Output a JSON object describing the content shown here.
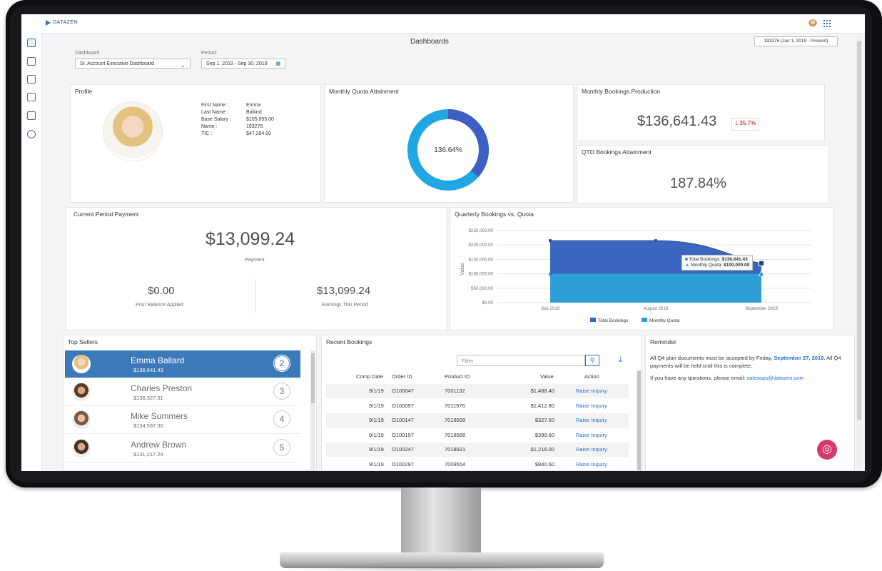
{
  "app": {
    "logo": "DATAZEN",
    "page_title": "Dashboards",
    "period_badge": "193276 (Jan 1, 2019 - Present)"
  },
  "filters": {
    "dashboard_label": "Dashboard",
    "dashboard_value": "Sr. Account Executive Dashboard",
    "period_label": "Period:",
    "period_value": "Sep 1, 2019 - Sep 30, 2019"
  },
  "profile": {
    "title": "Profile",
    "fields": [
      {
        "label": "First Name :",
        "value": "Emma"
      },
      {
        "label": "Last Name :",
        "value": "Ballard"
      },
      {
        "label": "Base Salary :",
        "value": "$105,855.00"
      },
      {
        "label": "Name :",
        "value": "193276"
      },
      {
        "label": "TIC :",
        "value": "$47,284.00"
      }
    ]
  },
  "quota": {
    "title": "Monthly Quota Attainment",
    "value_label": "136.64%",
    "value": 136.64,
    "colors": {
      "base": "#1fa6e3",
      "over": "#3d5fc4"
    }
  },
  "bookings": {
    "title": "Monthly Bookings Production",
    "value": "$136,641.43",
    "trend": "35.7%",
    "trend_color": "#bb0000"
  },
  "qtd": {
    "title": "QTD Bookings Attainment",
    "value": "187.84%"
  },
  "payment": {
    "title": "Current Period Payment",
    "value": "$13,099.24",
    "caption": "Payment",
    "prior_value": "$0.00",
    "prior_caption": "Prior Balance Applied",
    "earnings_value": "$13,099.24",
    "earnings_caption": "Earnings This Period"
  },
  "quarterly": {
    "title": "Quarterly Bookings vs. Quota",
    "tooltip": [
      {
        "label": "Total Bookings:",
        "value": "$136,641.43"
      },
      {
        "label": "Monthly Quota:",
        "value": "$100,000.00"
      }
    ]
  },
  "chart_data": {
    "type": "area",
    "title": "Quarterly Bookings vs. Quota",
    "ylabel": "Value",
    "xlabel": "",
    "categories": [
      "July 2019",
      "August 2019",
      "September 2019"
    ],
    "y_ticks": [
      "$250,000.00",
      "$200,000.00",
      "$150,000.00",
      "$100,000.00",
      "$50,000.00",
      "$0.00"
    ],
    "ylim": [
      0,
      250000
    ],
    "grid": true,
    "legend": "bottom",
    "series": [
      {
        "name": "Total Bookings",
        "values": [
          215000,
          215000,
          136641.43
        ],
        "color": "#3a66bf"
      },
      {
        "name": "Monthly Quota",
        "values": [
          100000,
          100000,
          100000
        ],
        "color": "#2e9fd6"
      }
    ]
  },
  "sellers": {
    "title": "Top Sellers",
    "items": [
      {
        "name": "Emma Ballard",
        "amount": "$136,641.43",
        "rank": "2",
        "selected": true
      },
      {
        "name": "Charles Preston",
        "amount": "$136,327.31",
        "rank": "3"
      },
      {
        "name": "Mike Summers",
        "amount": "$134,567.30",
        "rank": "4"
      },
      {
        "name": "Andrew Brown",
        "amount": "$131,217.24",
        "rank": "5"
      }
    ]
  },
  "recent": {
    "title": "Recent Bookings",
    "filter_placeholder": "Filter",
    "columns": [
      "Comp Date",
      "Order ID",
      "Product ID",
      "Value",
      "Action"
    ],
    "rows": [
      {
        "date": "9/1/19",
        "order": "O100047",
        "product": "7001132",
        "value": "$1,488.40",
        "action": "Raise Inquiry"
      },
      {
        "date": "9/1/19",
        "order": "O100097",
        "product": "7011976",
        "value": "$1,412.80",
        "action": "Raise Inquiry"
      },
      {
        "date": "9/1/19",
        "order": "O100147",
        "product": "7018599",
        "value": "$327.60",
        "action": "Raise Inquiry"
      },
      {
        "date": "9/1/19",
        "order": "O100197",
        "product": "7018588",
        "value": "$399.60",
        "action": "Raise Inquiry"
      },
      {
        "date": "9/1/19",
        "order": "O100247",
        "product": "7018921",
        "value": "$1,216.00",
        "action": "Raise Inquiry"
      },
      {
        "date": "9/1/19",
        "order": "O100297",
        "product": "7009554",
        "value": "$840.60",
        "action": "Raise Inquiry"
      }
    ]
  },
  "reminder": {
    "title": "Reminder",
    "line1_pre": "All Q4 plan documents must be accepted by Friday, ",
    "line1_date": "September 27, 2019.",
    "line1_post": " All Q4 payments will be held until this is complete.",
    "line2_pre": "If you have any questions, please email: ",
    "email": "salesops@datazen.com"
  }
}
